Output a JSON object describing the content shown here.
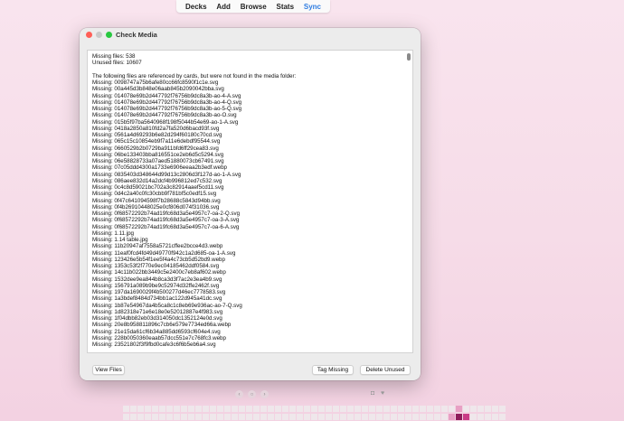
{
  "toolbar": {
    "items": [
      "Decks",
      "Add",
      "Browse",
      "Stats",
      "Sync"
    ],
    "active": "Sync",
    "active_color": "#2f7de1"
  },
  "window": {
    "title": "Check Media",
    "traffic_lights": [
      "close",
      "minimize",
      "maximize"
    ]
  },
  "report": {
    "lines": [
      "Missing files: 538",
      "Unused files: 10607",
      "",
      "The following files are referenced by cards, but were not found in the media folder:",
      "Missing: 0098747a75b6afe80cc66fc8590f1c1e.svg",
      "Missing: 00a445d3b848e06aab845b2090042bba.svg",
      "Missing: 014078e69b2d447792f76756b9dc8a3b-ao-4-A.svg",
      "Missing: 014078e69b2d447792f76756b9dc8a3b-ao-4-Q.svg",
      "Missing: 014078e69b2d447792f76756b9dc8a3b-ao-5-Q.svg",
      "Missing: 014078e69b2d447792f76756b9dc8a3b-ao-O.svg",
      "Missing: 015b5f97ba5640968f198f5044b54e69-ao-1-A.svg",
      "Missing: 0418a2850a810fd2a7fa520d6bacd93f.svg",
      "Missing: 0561a4d69293b6e82d294f60180c70cd.svg",
      "Missing: 065c15c10854eb9f7a11e6debdf95544.svg",
      "Missing: 0660529b2b0729ba911bfd6ff29cea83.svg",
      "Missing: 06be133403bba816551ce2eb6d5c5294.svg",
      "Missing: 06e58828733a07aed51880073cb67491.svg",
      "Missing: 07c05ddd4300a1733e6906eeaa2b3edf.webp",
      "Missing: 0835403d348644d99d13c2806d3f127d-ao-1-A.svg",
      "Missing: 086aee832d14a2dcf4b996812ed7c532.svg",
      "Missing: 0c4c8d59021bc702a3c82914aaef5cd11.svg",
      "Missing: 0d4c2a40c0fc30cbb9f781bf5c0edf15.svg",
      "Missing: 0f47c641094598f7b28688c5843d94bb.svg",
      "Missing: 0f4b26910448025e0cf806d074f31036.svg",
      "Missing: 0f68572292b74ad19fc68d3a5e4957c7-oa-2-Q.svg",
      "Missing: 0f68572292b74ad19fc68d3a5e4957c7-oa-3-A.svg",
      "Missing: 0f68572292b74ad19fc68d3a5e4957c7-oa-6-A.svg",
      "Missing: 1.11.jpg",
      "Missing: 1.14 table.jpg",
      "Missing: 11b20947af7558a5721cffee2bcce4d3.webp",
      "Missing: 11eaf0fcd4fd49d49770f942c1a2d685-oa-1-A.svg",
      "Missing: 123426e5b54f1ee5f4a4c73cb5d52bd9.webp",
      "Missing: 1353c53f2f770e9ec04185462ddf0584.svg",
      "Missing: 14c11b022bb3449c5e2400c7eb8af602.webp",
      "Missing: 1532dee9ea844b8ca3d3f7ac2e3ea4b9.svg",
      "Missing: 156791a089b9be9c52974d32ffe2462f.svg",
      "Missing: 197da1690029f4b500277d46ec7778583.svg",
      "Missing: 1a3bdef8484d734bb1ac122d945a41dc.svg",
      "Missing: 1b87e54967da4b5ca8c1c8eb69e936ac-ao-7-Q.svg",
      "Missing: 1d82318e71e6e18e0e52012887e4f983.svg",
      "Missing: 1f04dbb82eb03d314050dc1352124e0d.svg",
      "Missing: 20e8b958811896c7cb6e579e7734ed66a.webp",
      "Missing: 21e15da61cf6b34a885dd6593cf604e4.svg",
      "Missing: 228b0050360eaab57dcc551e7c768fc3.webp",
      "Missing: 23521802f3f9fbd0cafe3c6f6b5eb6a4.svg"
    ]
  },
  "buttons": {
    "view_files": "View Files",
    "tag_missing": "Tag Missing",
    "delete_unused": "Delete Unused"
  },
  "heatmap": {
    "levels_col_45": [
      0,
      1,
      2
    ],
    "levels_col_46": [
      1,
      3,
      2
    ],
    "levels_col_47": [
      0,
      2,
      1
    ],
    "colors": [
      "#efe7eb",
      "#e8a0c4",
      "#c93b86",
      "#8e1c5a"
    ]
  }
}
